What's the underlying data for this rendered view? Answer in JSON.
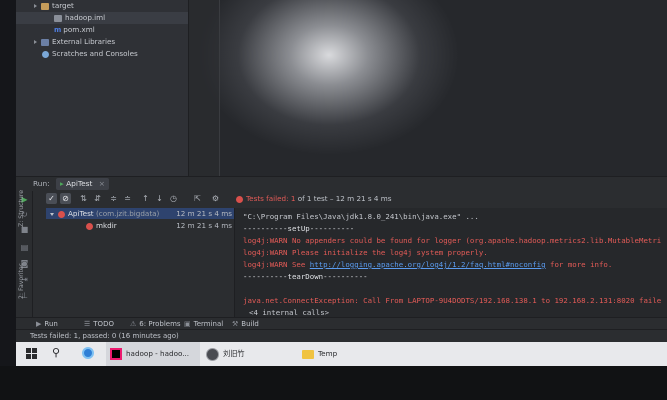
{
  "project_tree": {
    "items": [
      {
        "label": "target",
        "icon": "folder-icon"
      },
      {
        "label": "hadoop.iml",
        "icon": "iml-file-icon"
      },
      {
        "label": "pom.xml",
        "icon": "maven-file-icon",
        "prefix": "m"
      },
      {
        "label": "External Libraries",
        "icon": "library-icon"
      },
      {
        "label": "Scratches and Consoles",
        "icon": "scratch-icon"
      }
    ]
  },
  "run_window": {
    "label": "Run:",
    "tab": "ApiTest",
    "close": "×",
    "status": {
      "prefix": "Tests failed:",
      "count": "1",
      "rest": "of 1 test – 12 m 21 s 4 ms"
    },
    "tests": [
      {
        "name": "ApiTest",
        "pkg": "(com.jzit.bigdata)",
        "time": "12 m 21 s 4 ms"
      },
      {
        "name": "mkdir",
        "pkg": "",
        "time": "12 m 21 s 4 ms"
      }
    ],
    "console": {
      "cmd": "\"C:\\Program Files\\Java\\jdk1.8.0_241\\bin\\java.exe\" ...",
      "setup": "----------setUp----------",
      "warn1": "log4j:WARN No appenders could be found for logger (org.apache.hadoop.metrics2.lib.MutableMetri",
      "warn2": "log4j:WARN Please initialize the log4j system properly.",
      "warn3_prefix": "log4j:WARN See",
      "warn3_link": "http://logging.apache.org/log4j/1.2/faq.html#noconfig",
      "warn3_suffix": "for more info.",
      "teardown": "----------tearDown----------",
      "exception": "java.net.ConnectException: Call From LAPTOP-9U4DODTS/192.168.138.1 to 192.168.2.131:8020 faile",
      "internal": "<4 internal calls>"
    }
  },
  "side_labels": {
    "structure": "Z: Structure",
    "favorites": "2: Favorites"
  },
  "bottom_tabs": [
    {
      "label": "Run",
      "sym": "▶"
    },
    {
      "label": "TODO",
      "sym": "☰"
    },
    {
      "label": "6: Problems",
      "sym": "⚠"
    },
    {
      "label": "Terminal",
      "sym": "▣"
    },
    {
      "label": "Build",
      "sym": "⚒"
    }
  ],
  "statusbar": "Tests failed: 1, passed: 0 (16 minutes ago)",
  "taskbar": {
    "app1": "hadoop - hadoo...",
    "app2": "刘旧竹",
    "app3": "Temp"
  },
  "colors": {
    "error": "#e45b57",
    "link": "#5b9cf0",
    "selection": "#2e436e",
    "success": "#4ea85b"
  }
}
